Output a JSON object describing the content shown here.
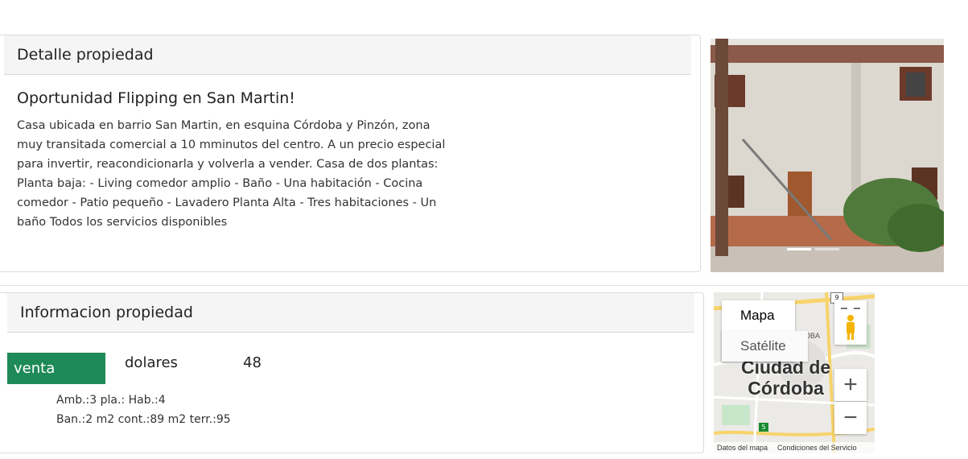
{
  "detail": {
    "header": "Detalle propiedad",
    "title": "Oportunidad Flipping en San Martin!",
    "description": "Casa ubicada en barrio San Martin, en esquina Córdoba y Pinzón, zona muy transitada comercial a 10 mminutos del centro. A un precio especial para invertir, reacondicionarla y volverla a vender. Casa de dos plantas: Planta baja: - Living comedor amplio - Baño - Una habitación - Cocina comedor - Patio pequeño - Lavadero Planta Alta - Tres habitaciones - Un baño Todos los servicios disponibles"
  },
  "info": {
    "header": "Informacion propiedad",
    "operation": "venta",
    "currency": "dolares",
    "price": "48",
    "features_line1": "Amb.:3 pla.: Hab.:4",
    "features_line2": "Ban.:2 m2 cont.:89 m2 terr.:95"
  },
  "map": {
    "type_map": "Mapa",
    "type_satellite": "Satélite",
    "city_line1": "Ciudad de",
    "city_line2": "Córdoba",
    "label_oba": "OBA",
    "route_9": "9",
    "route_5": "5",
    "zoom_in": "+",
    "zoom_out": "−",
    "footer_data": "Datos del mapa",
    "footer_terms": "Condiciones del Servicio"
  },
  "colors": {
    "venta_badge": "#1e8a57",
    "header_bg": "#f5f5f5"
  }
}
